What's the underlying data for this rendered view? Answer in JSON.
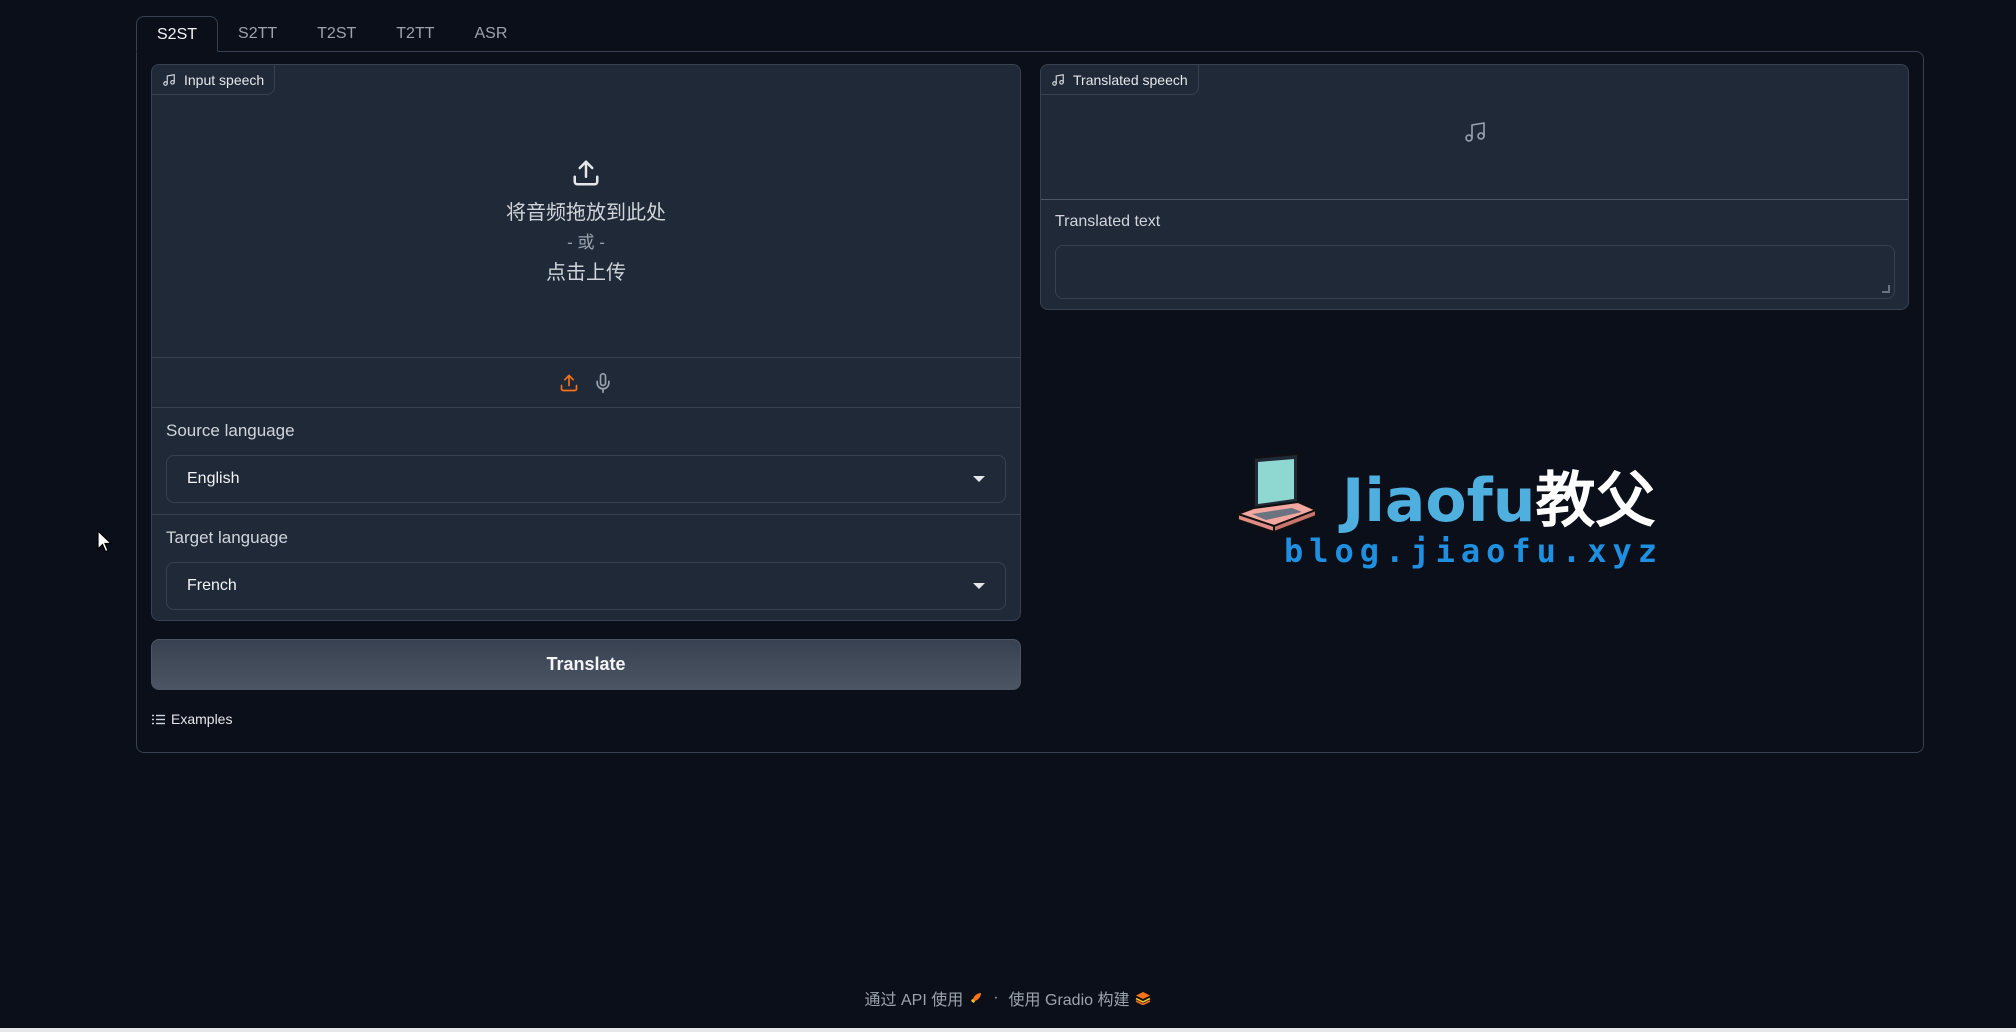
{
  "tabs": [
    {
      "label": "S2ST",
      "active": true
    },
    {
      "label": "S2TT",
      "active": false
    },
    {
      "label": "T2ST",
      "active": false
    },
    {
      "label": "T2TT",
      "active": false
    },
    {
      "label": "ASR",
      "active": false
    }
  ],
  "input_speech": {
    "label": "Input speech",
    "drop_text": "将音频拖放到此处",
    "or_text": "- 或 -",
    "click_text": "点击上传",
    "source_icons": [
      "upload-icon",
      "microphone-icon"
    ]
  },
  "source_language": {
    "label": "Source language",
    "value": "English"
  },
  "target_language": {
    "label": "Target language",
    "value": "French"
  },
  "translate_button": "Translate",
  "examples_label": "Examples",
  "output": {
    "speech_label": "Translated speech",
    "text_label": "Translated text",
    "text_value": ""
  },
  "watermark": {
    "brand": "Jiaofu",
    "brand_cn": "教父",
    "url": "blog.jiaofu.xyz"
  },
  "footer": {
    "api_text": "通过 API 使用",
    "separator": "·",
    "built_text": "使用 Gradio 构建"
  },
  "colors": {
    "background": "#0b0f19",
    "panel": "#1f2937",
    "border": "#374151",
    "accent_orange": "#f97316",
    "watermark_blue": "#4fb0e0"
  }
}
